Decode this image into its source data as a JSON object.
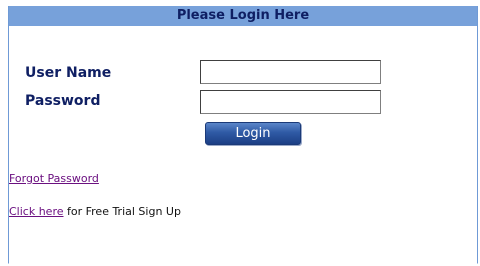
{
  "header": {
    "title": "Please Login Here"
  },
  "login_form": {
    "username_label": "User Name",
    "username_value": "",
    "password_label": "Password",
    "password_value": "",
    "login_button_label": "Login"
  },
  "links": {
    "forgot_password": "Forgot Password",
    "click_here": "Click here",
    "trial_suffix": " for Free Trial Sign Up"
  },
  "colors": {
    "header_background": "#77a1da",
    "label_text": "#0f1f63",
    "link_text": "#6b1080",
    "button_background": "#2f5aa5"
  }
}
